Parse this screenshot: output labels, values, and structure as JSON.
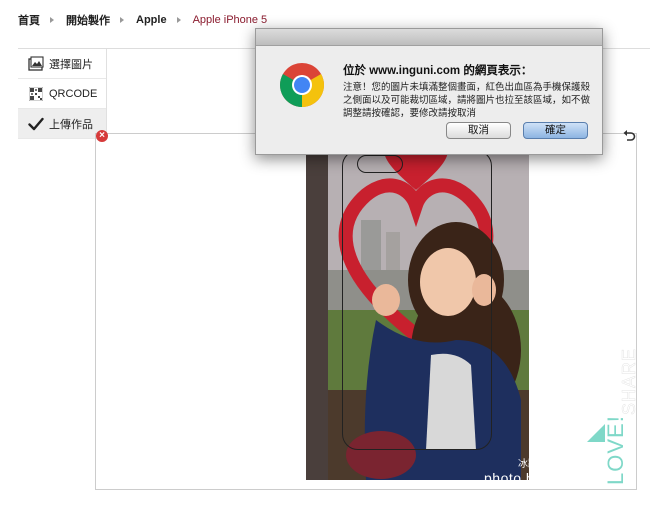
{
  "breadcrumb": {
    "items": [
      "首頁",
      "開始製作",
      "Apple",
      "Apple iPhone 5"
    ]
  },
  "sidebar": {
    "items": [
      {
        "label": "選擇圖片",
        "icon": "image-icon"
      },
      {
        "label": "QRCODE",
        "icon": "qrcode-icon"
      },
      {
        "label": "上傳作品",
        "icon": "checkmark-icon",
        "active": true
      }
    ]
  },
  "photo": {
    "watermark_cn": "冰蹦拉 美食旅行",
    "watermark_en": "photo by miha.tw",
    "love_text": "LOVE! SHARE"
  },
  "dialog": {
    "title": "位於 www.inguni.com 的網頁表示：",
    "message": "注意！您的圖片未填滿整個畫面，紅色出血區為手機保護殼之側面以及可能裁切區域，請將圖片也拉至該區域，如不做調整請按確認，要修改請按取消",
    "cancel_label": "取消",
    "ok_label": "確定",
    "icon": "chrome-icon"
  },
  "colors": {
    "breadcrumb_current": "#8a1b2e",
    "heart_red": "#c8202e",
    "love_teal": "#7fd8c8"
  }
}
